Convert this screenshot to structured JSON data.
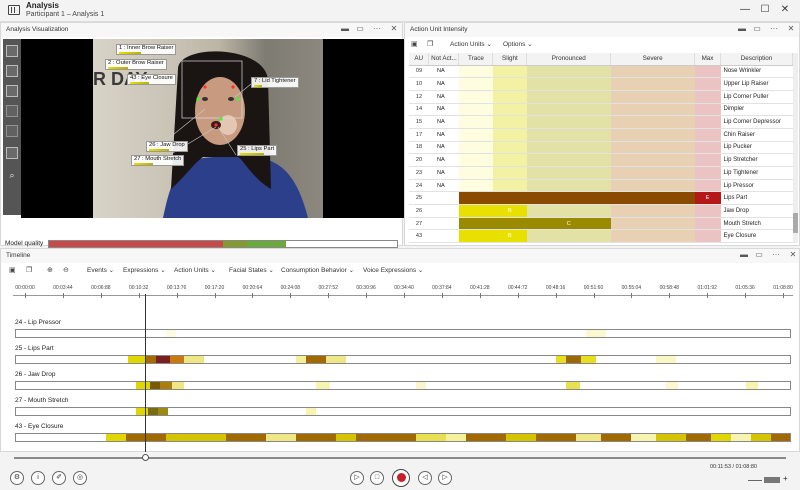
{
  "window": {
    "title": "Analysis",
    "subtitle": "Participant 1 – Analysis 1"
  },
  "vis": {
    "title": "Analysis Visualization",
    "model_quality_label": "Model quality",
    "model_quality_segments": [
      {
        "color": "#c84a48",
        "pct": 50
      },
      {
        "color": "#849a2e",
        "pct": 7
      },
      {
        "color": "#6aaa3a",
        "pct": 11
      },
      {
        "color": "#ffffff",
        "pct": 32
      }
    ],
    "overlay_labels": [
      {
        "text": "1 : Inner Brow Raiser"
      },
      {
        "text": "2 : Outer Brow Raiser"
      },
      {
        "text": "43 : Eye Closure"
      },
      {
        "text": "7 : Lid Tightener"
      },
      {
        "text": "26 : Jaw Drop"
      },
      {
        "text": "27 : Mouth Stretch"
      },
      {
        "text": "25 : Lips Part"
      }
    ],
    "scene_text": "R DAY"
  },
  "au": {
    "title": "Action Unit Intensity",
    "toolbar": {
      "action_units": "Action Units",
      "options": "Options"
    },
    "columns": [
      "AU",
      "Not Act...",
      "Trace",
      "Slight",
      "Pronounced",
      "Severe",
      "Max",
      "Description"
    ],
    "rows": [
      {
        "au": "09",
        "na": "NA",
        "desc": "Nose Wrinkler",
        "cells": [
          "",
          "",
          "",
          "",
          ""
        ],
        "partial": true
      },
      {
        "au": "10",
        "na": "NA",
        "desc": "Upper Lip Raiser",
        "cells": [
          "",
          "",
          "",
          "",
          ""
        ]
      },
      {
        "au": "12",
        "na": "NA",
        "desc": "Lip Corner Puller",
        "cells": [
          "",
          "",
          "",
          "",
          ""
        ]
      },
      {
        "au": "14",
        "na": "NA",
        "desc": "Dimpler",
        "cells": [
          "",
          "",
          "",
          "",
          ""
        ]
      },
      {
        "au": "15",
        "na": "NA",
        "desc": "Lip Corner Depressor",
        "cells": [
          "",
          "",
          "",
          "",
          ""
        ]
      },
      {
        "au": "17",
        "na": "NA",
        "desc": "Chin Raiser",
        "cells": [
          "",
          "",
          "",
          "",
          ""
        ]
      },
      {
        "au": "18",
        "na": "NA",
        "desc": "Lip Pucker",
        "cells": [
          "",
          "",
          "",
          "",
          ""
        ]
      },
      {
        "au": "20",
        "na": "NA",
        "desc": "Lip Stretcher",
        "cells": [
          "",
          "",
          "",
          "",
          ""
        ]
      },
      {
        "au": "23",
        "na": "NA",
        "desc": "Lip Tightener",
        "cells": [
          "",
          "",
          "",
          "",
          ""
        ]
      },
      {
        "au": "24",
        "na": "NA",
        "desc": "Lip Pressor",
        "cells": [
          "",
          "",
          "",
          "",
          ""
        ]
      },
      {
        "au": "25",
        "na": "",
        "desc": "Lips Part",
        "cells": [
          "",
          "",
          "",
          "",
          ""
        ],
        "fill": 5,
        "fill_text": "E"
      },
      {
        "au": "26",
        "na": "",
        "desc": "Jaw Drop",
        "cells": [
          "",
          "",
          "",
          "",
          ""
        ],
        "fill": 2,
        "fill_text": "B"
      },
      {
        "au": "27",
        "na": "",
        "desc": "Mouth Stretch",
        "cells": [
          "",
          "",
          "",
          "",
          ""
        ],
        "fill": 3,
        "fill_text": "C"
      },
      {
        "au": "43",
        "na": "",
        "desc": "Eye Closure",
        "cells": [
          "",
          "",
          "",
          "",
          ""
        ],
        "fill": 2,
        "fill_text": "B"
      }
    ]
  },
  "timeline": {
    "title": "Timeline",
    "toolbar": [
      "Events",
      "Expressions",
      "Action Units",
      "Facial States",
      "Consumption Behavior",
      "Voice Expressions"
    ],
    "ticks": [
      "00:00:00",
      "00:03:44",
      "00:06:88",
      "00:10:32",
      "00:13:76",
      "00:17:20",
      "00:20:64",
      "00:24:08",
      "00:27:52",
      "00:30:96",
      "00:34:40",
      "00:37:84",
      "00:41:28",
      "00:44:72",
      "00:48:16",
      "00:51:60",
      "00:55:04",
      "00:58:48",
      "01:01:92",
      "01:05:36",
      "01:08:80"
    ],
    "tracks": [
      {
        "label": "24 - Lip Pressor",
        "segs": [
          [
            150,
            10,
            "#fbfbe3"
          ],
          [
            570,
            20,
            "#f9f8cf"
          ]
        ]
      },
      {
        "label": "25 - Lips Part",
        "segs": [
          [
            112,
            18,
            "#e1d700"
          ],
          [
            130,
            10,
            "#a36b00"
          ],
          [
            140,
            14,
            "#7a1f1f"
          ],
          [
            154,
            14,
            "#c87a10"
          ],
          [
            168,
            20,
            "#efe785"
          ],
          [
            280,
            10,
            "#f3ef9a"
          ],
          [
            290,
            20,
            "#a06a00"
          ],
          [
            310,
            20,
            "#efe785"
          ],
          [
            540,
            10,
            "#e8de20"
          ],
          [
            550,
            15,
            "#9a6a00"
          ],
          [
            565,
            15,
            "#e8de20"
          ],
          [
            640,
            20,
            "#faf7c6"
          ]
        ]
      },
      {
        "label": "26 - Jaw Drop",
        "segs": [
          [
            120,
            14,
            "#e1d700"
          ],
          [
            134,
            10,
            "#7a5a00"
          ],
          [
            144,
            12,
            "#a97e0f"
          ],
          [
            156,
            12,
            "#efe785"
          ],
          [
            300,
            14,
            "#f7f3b0"
          ],
          [
            400,
            10,
            "#f9f6cd"
          ],
          [
            550,
            14,
            "#e8e050"
          ],
          [
            650,
            12,
            "#fbf8cf"
          ],
          [
            730,
            12,
            "#f7f3b0"
          ]
        ]
      },
      {
        "label": "27 - Mouth Stretch",
        "segs": [
          [
            120,
            12,
            "#e1d700"
          ],
          [
            132,
            10,
            "#7a6a10"
          ],
          [
            142,
            10,
            "#9a8a10"
          ],
          [
            290,
            10,
            "#f7f3b0"
          ]
        ]
      },
      {
        "label": "43 - Eye Closure",
        "segs": [
          [
            90,
            20,
            "#e1d700"
          ],
          [
            110,
            40,
            "#a06a00"
          ],
          [
            150,
            60,
            "#d4c400"
          ],
          [
            210,
            40,
            "#a06a00"
          ],
          [
            250,
            30,
            "#efe785"
          ],
          [
            280,
            40,
            "#a06a00"
          ],
          [
            320,
            20,
            "#d4c400"
          ],
          [
            340,
            60,
            "#a06a00"
          ],
          [
            400,
            30,
            "#e8e050"
          ],
          [
            430,
            20,
            "#f5f19a"
          ],
          [
            450,
            40,
            "#a06a00"
          ],
          [
            490,
            30,
            "#d4c400"
          ],
          [
            520,
            40,
            "#a06a00"
          ],
          [
            560,
            25,
            "#efe785"
          ],
          [
            585,
            30,
            "#a06a00"
          ],
          [
            615,
            25,
            "#f7f3b0"
          ],
          [
            640,
            30,
            "#d4c400"
          ],
          [
            670,
            25,
            "#a06a00"
          ],
          [
            695,
            20,
            "#e1d700"
          ],
          [
            715,
            20,
            "#f7f3b0"
          ],
          [
            735,
            20,
            "#d4c400"
          ],
          [
            755,
            20,
            "#a06a00"
          ]
        ]
      }
    ],
    "time_readout": "00:11:53 / 01:08:80"
  },
  "colors": {
    "accent_red": "#c8202a",
    "slight": "#f1ef9b",
    "pronounced": "#e2e2a2",
    "severe": "#ddc8a0",
    "max": "#e8b8b8"
  }
}
